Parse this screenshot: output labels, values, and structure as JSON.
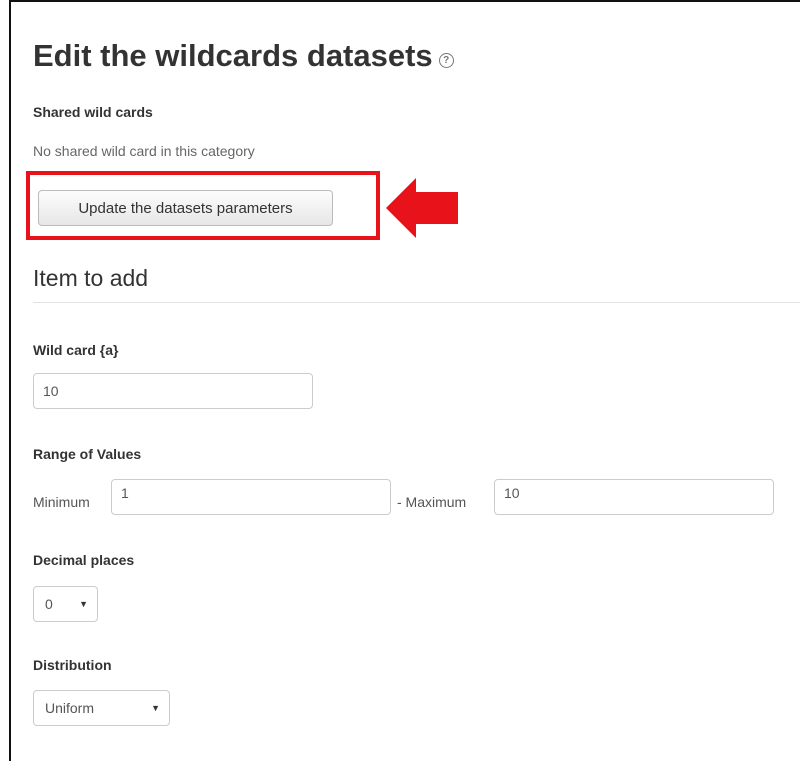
{
  "header": {
    "title": "Edit the wildcards datasets",
    "help_glyph": "?"
  },
  "shared": {
    "heading": "Shared wild cards",
    "empty_text": "No shared wild card in this category",
    "update_button_label": "Update the datasets parameters"
  },
  "annotation": {
    "highlight_color": "#e8131a",
    "arrow_color": "#e8131a",
    "arrow_direction": "left"
  },
  "item_to_add": {
    "section_title": "Item to add",
    "wildcard": {
      "label": "Wild card {a}",
      "value": "10"
    },
    "range": {
      "label": "Range of Values",
      "minimum_label": "Minimum",
      "minimum_value": "1",
      "maximum_label": "- Maximum",
      "maximum_value": "10"
    },
    "decimal_places": {
      "label": "Decimal places",
      "selected": "0"
    },
    "distribution": {
      "label": "Distribution",
      "selected": "Uniform"
    }
  }
}
